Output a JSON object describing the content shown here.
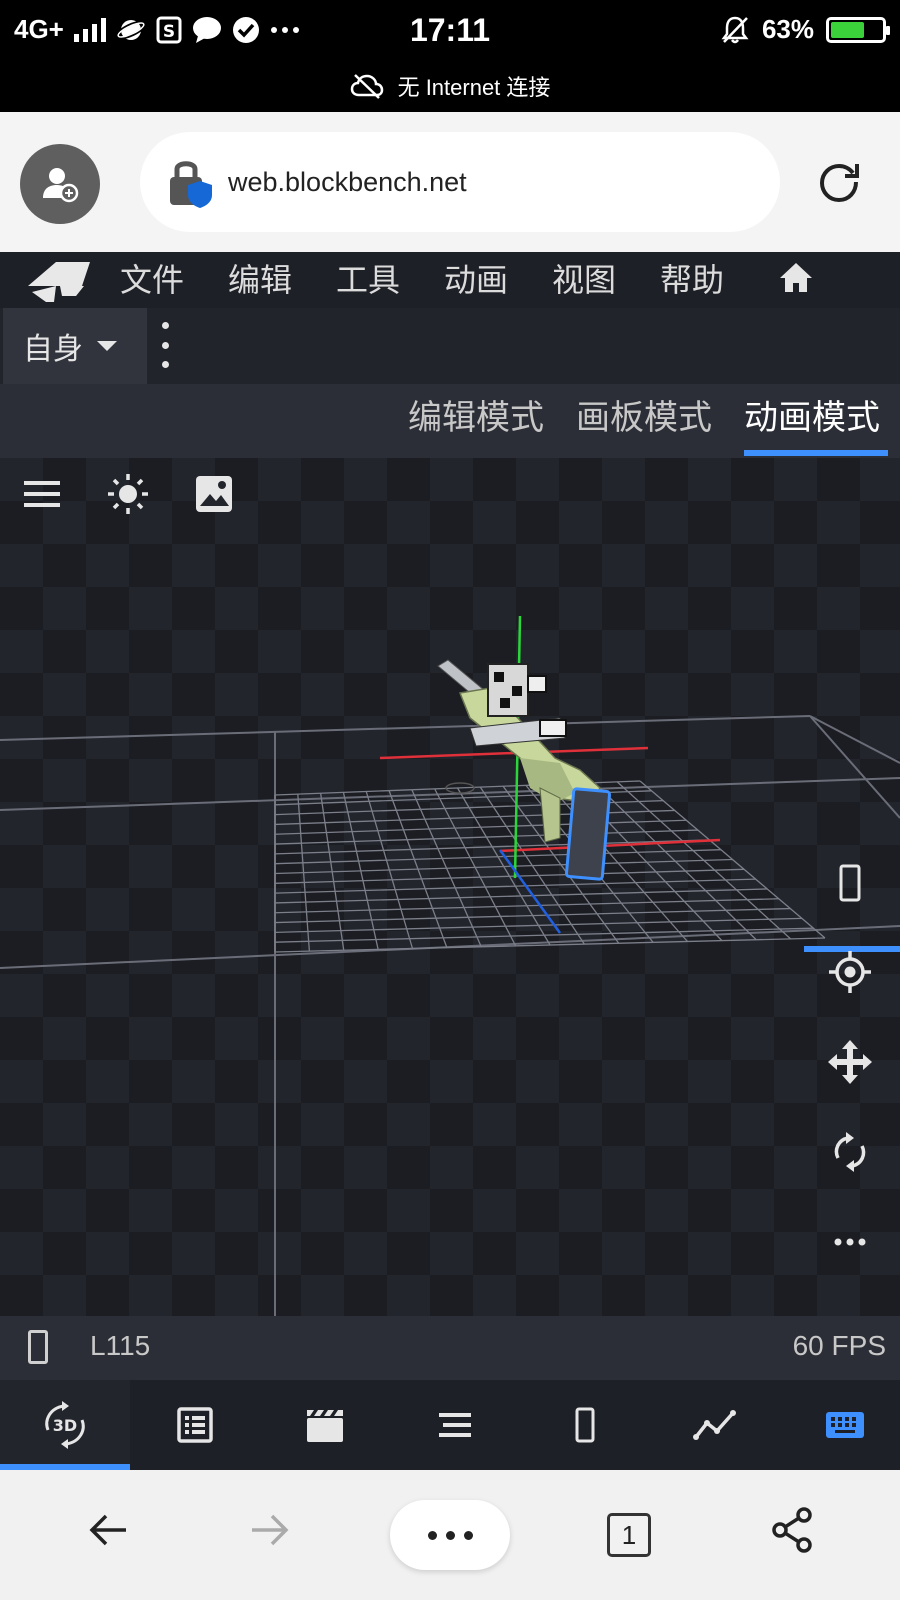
{
  "status_bar": {
    "network": "4G+",
    "time": "17:11",
    "battery": "63%",
    "battery_level": 0.63,
    "notice": "无 Internet 连接"
  },
  "browser": {
    "url": "web.blockbench.net"
  },
  "menu": {
    "items": [
      "文件",
      "编辑",
      "工具",
      "动画",
      "视图",
      "帮助"
    ]
  },
  "toolbar": {
    "space_label": "自身"
  },
  "modes": {
    "tabs": [
      "编辑模式",
      "画板模式",
      "动画模式"
    ],
    "active": "动画模式"
  },
  "info": {
    "line": "L115",
    "fps": "60 FPS"
  },
  "nav": {
    "tab_count": "1"
  },
  "colors": {
    "accent": "#3e90ff",
    "menu_bg": "#1e2027",
    "viewport_bg": "#23252c"
  }
}
